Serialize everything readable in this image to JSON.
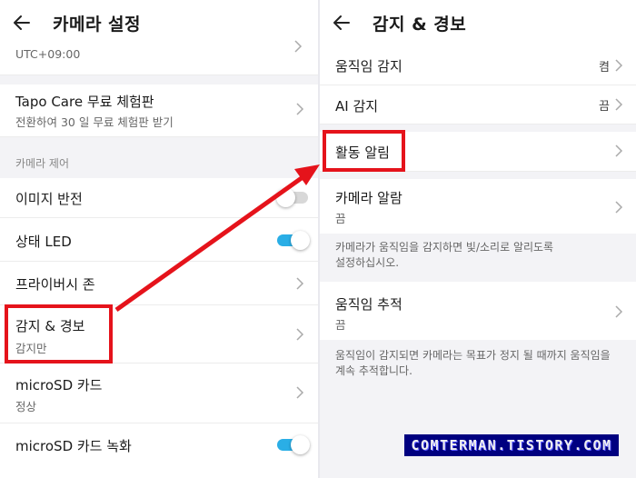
{
  "left": {
    "title": "카메라 설정",
    "timezone_value": "UTC+09:00",
    "tapo_care": {
      "label": "Tapo Care 무료 체험판",
      "sub": "전환하여 30 일 무료 체험판 받기"
    },
    "section_camera_control": "카메라 제어",
    "image_flip": {
      "label": "이미지 반전",
      "enabled": false
    },
    "status_led": {
      "label": "상태 LED",
      "enabled": true
    },
    "privacy_zone": {
      "label": "프라이버시 존"
    },
    "detection_alert": {
      "label": "감지 & 경보",
      "sub": "감지만"
    },
    "microsd": {
      "label": "microSD 카드",
      "sub": "정상"
    },
    "microsd_record": {
      "label": "microSD 카드 녹화",
      "enabled": true
    }
  },
  "right": {
    "title": "감지 & 경보",
    "motion_detection": {
      "label": "움직임 감지",
      "value": "켬"
    },
    "ai_detection": {
      "label": "AI 감지",
      "value": "끔"
    },
    "activity_notification": {
      "label": "활동 알림"
    },
    "camera_alarm": {
      "label": "카메라 알람",
      "sub": "끔",
      "desc_line1": "카메라가 움직임을 감지하면 빛/소리로 알리도록",
      "desc_line2": "설정하십시오."
    },
    "motion_tracking": {
      "label": "움직임 추적",
      "sub": "끔",
      "desc_line1": "움직임이 감지되면 카메라는 목표가 정지 될 때까지 움직임을",
      "desc_line2": "계속 추적합니다."
    }
  },
  "watermark": "COMTERMAN.TISTORY.COM",
  "colors": {
    "highlight": "#e5131b",
    "toggle_on": "#2aaee6",
    "watermark_bg": "#000080"
  },
  "icons": [
    "back-arrow-icon",
    "chevron-right-icon"
  ]
}
